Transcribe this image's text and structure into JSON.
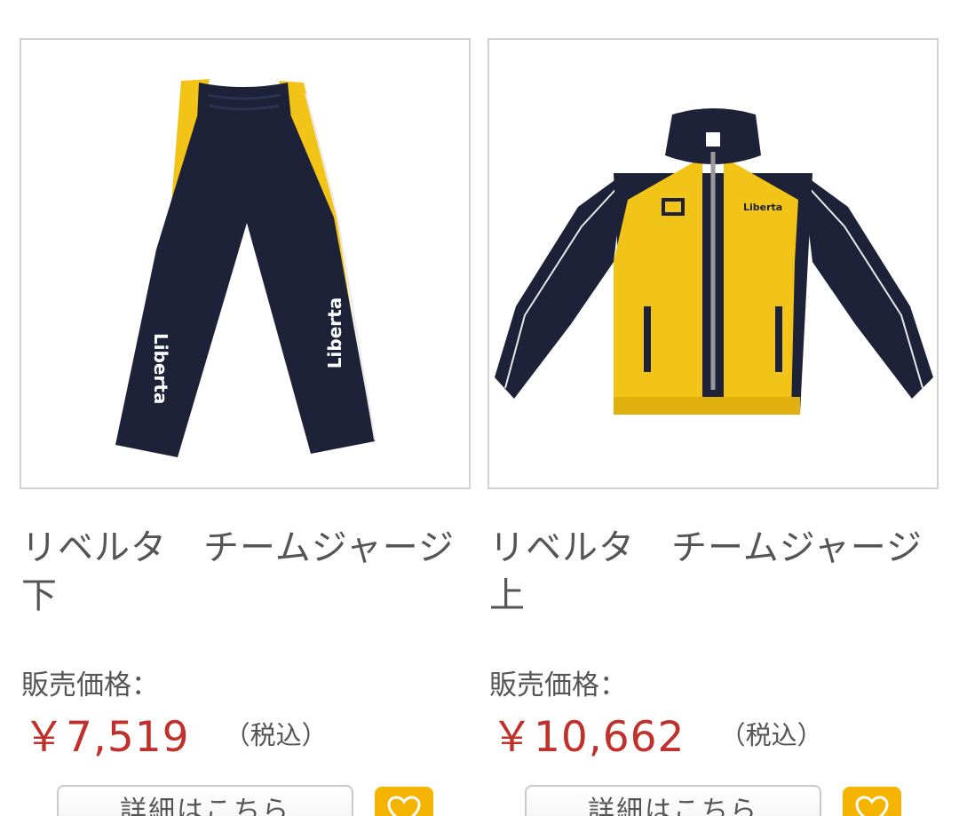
{
  "products": [
    {
      "title": "リベルタ　チームジャージ\n下",
      "price_label": "販売価格：",
      "price": "￥7,519",
      "tax_note": "（税込）",
      "detail_button": "詳細はこちら",
      "image_icon": "track-pants-image",
      "brand_mark": "Liberta"
    },
    {
      "title": "リベルタ　チームジャージ\n上",
      "price_label": "販売価格：",
      "price": "￥10,662",
      "tax_note": "（税込）",
      "detail_button": "詳細はこちら",
      "image_icon": "track-jacket-image",
      "brand_mark": "Liberta"
    }
  ],
  "colors": {
    "price": "#c0312c",
    "favorite": "#f5b400",
    "navy": "#1d2238",
    "yellow": "#f2c417"
  },
  "favorite_icon": "heart-icon"
}
